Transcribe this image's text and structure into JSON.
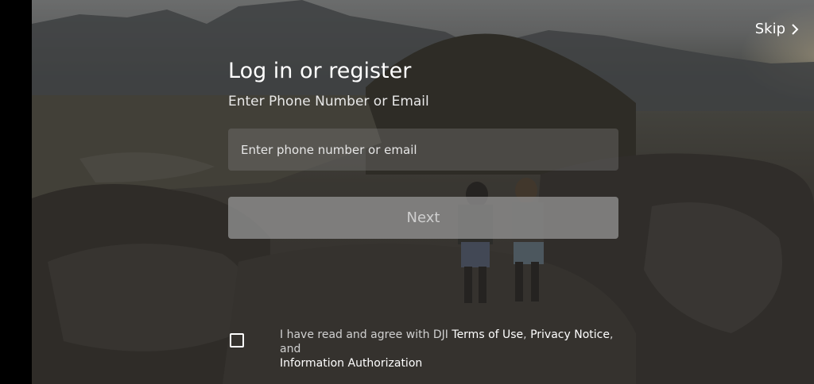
{
  "skip": {
    "label": "Skip"
  },
  "login": {
    "title": "Log in or register",
    "subtitle": "Enter Phone Number or Email",
    "input_placeholder": "Enter phone number or email",
    "input_value": "",
    "next_label": "Next"
  },
  "agreement": {
    "checked": false,
    "prefix": "I have read and agree with DJI ",
    "terms_label": "Terms of Use",
    "sep1": ", ",
    "privacy_label": "Privacy Notice",
    "sep2": ", and",
    "info_label": "Information Authorization"
  },
  "colors": {
    "text_primary": "#ffffff",
    "button_disabled_bg": "#8f8f8f",
    "input_bg": "#6a6a6a"
  },
  "icons": {
    "skip": "chevron-right-icon",
    "checkbox": "checkbox-unchecked-icon"
  }
}
